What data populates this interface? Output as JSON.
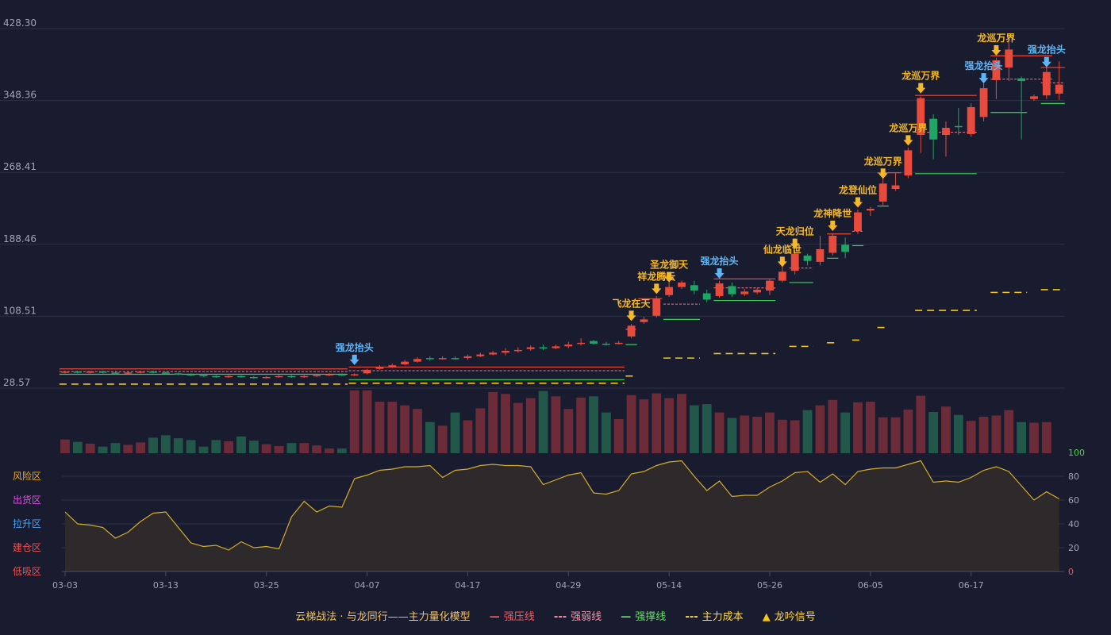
{
  "colors": {
    "background": "#191b2e",
    "grid": "#2e3146",
    "up": "#e84b3c",
    "down": "#1fa565",
    "up_dim": "#6b2b38",
    "down_dim": "#22584a",
    "resistance": "#e84b3c",
    "weak": "#f47c8f",
    "support": "#3ccf5a",
    "cost": "#f5c518",
    "signal_gold": "#f5b829",
    "signal_blue": "#5db5f5",
    "osc_line": "#d4ac2b",
    "osc_fill": "#2f2b2b",
    "axis_text": "#a4a4b4"
  },
  "chart_data": {
    "type": "candlestick",
    "price_axis": {
      "ticks": [
        "428.30",
        "348.36",
        "268.41",
        "188.46",
        "108.51",
        "28.57"
      ],
      "min": 28.57,
      "max": 428.3
    },
    "x_ticks": [
      {
        "label": "03-03",
        "index": 0
      },
      {
        "label": "03-13",
        "index": 8
      },
      {
        "label": "03-25",
        "index": 16
      },
      {
        "label": "04-07",
        "index": 24
      },
      {
        "label": "04-17",
        "index": 32
      },
      {
        "label": "04-29",
        "index": 40
      },
      {
        "label": "05-14",
        "index": 48
      },
      {
        "label": "05-26",
        "index": 56
      },
      {
        "label": "06-05",
        "index": 64
      },
      {
        "label": "06-17",
        "index": 72
      }
    ],
    "candles": [
      {
        "o": 46,
        "c": 47,
        "h": 48,
        "l": 45
      },
      {
        "o": 47,
        "c": 46,
        "h": 48,
        "l": 45
      },
      {
        "o": 46,
        "c": 47,
        "h": 48,
        "l": 45
      },
      {
        "o": 47,
        "c": 46,
        "h": 48,
        "l": 45
      },
      {
        "o": 46,
        "c": 45,
        "h": 47,
        "l": 44
      },
      {
        "o": 45,
        "c": 46,
        "h": 47,
        "l": 44
      },
      {
        "o": 46,
        "c": 47,
        "h": 48,
        "l": 45
      },
      {
        "o": 47,
        "c": 46,
        "h": 48,
        "l": 45
      },
      {
        "o": 46,
        "c": 45,
        "h": 47,
        "l": 44
      },
      {
        "o": 45,
        "c": 44,
        "h": 46,
        "l": 43
      },
      {
        "o": 44,
        "c": 43,
        "h": 45,
        "l": 42
      },
      {
        "o": 43,
        "c": 42,
        "h": 44,
        "l": 41
      },
      {
        "o": 42,
        "c": 41,
        "h": 43,
        "l": 40
      },
      {
        "o": 41,
        "c": 42,
        "h": 43,
        "l": 40
      },
      {
        "o": 42,
        "c": 41,
        "h": 43,
        "l": 40
      },
      {
        "o": 41,
        "c": 40,
        "h": 42,
        "l": 39
      },
      {
        "o": 40,
        "c": 41,
        "h": 42,
        "l": 39
      },
      {
        "o": 41,
        "c": 42,
        "h": 43,
        "l": 40
      },
      {
        "o": 42,
        "c": 41,
        "h": 43,
        "l": 40
      },
      {
        "o": 41,
        "c": 42,
        "h": 43,
        "l": 40
      },
      {
        "o": 42,
        "c": 43,
        "h": 44,
        "l": 41
      },
      {
        "o": 43,
        "c": 44,
        "h": 45,
        "l": 42
      },
      {
        "o": 44,
        "c": 43,
        "h": 45,
        "l": 42
      },
      {
        "o": 43,
        "c": 44,
        "h": 45,
        "l": 42
      },
      {
        "o": 45,
        "c": 49,
        "h": 50,
        "l": 44
      },
      {
        "o": 50,
        "c": 52,
        "h": 54,
        "l": 49
      },
      {
        "o": 52,
        "c": 54,
        "h": 56,
        "l": 51
      },
      {
        "o": 55,
        "c": 58,
        "h": 60,
        "l": 54
      },
      {
        "o": 58,
        "c": 61,
        "h": 63,
        "l": 57
      },
      {
        "o": 62,
        "c": 61,
        "h": 64,
        "l": 59
      },
      {
        "o": 61,
        "c": 62,
        "h": 64,
        "l": 60
      },
      {
        "o": 62,
        "c": 61,
        "h": 64,
        "l": 60
      },
      {
        "o": 62,
        "c": 64,
        "h": 66,
        "l": 60
      },
      {
        "o": 64,
        "c": 66,
        "h": 68,
        "l": 63
      },
      {
        "o": 66,
        "c": 68,
        "h": 70,
        "l": 65
      },
      {
        "o": 68,
        "c": 70,
        "h": 73,
        "l": 65
      },
      {
        "o": 70,
        "c": 71,
        "h": 74,
        "l": 68
      },
      {
        "o": 72,
        "c": 74,
        "h": 76,
        "l": 70
      },
      {
        "o": 74,
        "c": 73,
        "h": 77,
        "l": 71
      },
      {
        "o": 73,
        "c": 75,
        "h": 77,
        "l": 72
      },
      {
        "o": 75,
        "c": 77,
        "h": 80,
        "l": 73
      },
      {
        "o": 78,
        "c": 79,
        "h": 84,
        "l": 76
      },
      {
        "o": 81,
        "c": 78,
        "h": 82,
        "l": 77
      },
      {
        "o": 78,
        "c": 77,
        "h": 80,
        "l": 76
      },
      {
        "o": 78,
        "c": 79,
        "h": 81,
        "l": 77
      },
      {
        "o": 86,
        "c": 98,
        "h": 100,
        "l": 84
      },
      {
        "o": 102,
        "c": 105,
        "h": 108,
        "l": 100
      },
      {
        "o": 109,
        "c": 128,
        "h": 131,
        "l": 107
      },
      {
        "o": 132,
        "c": 141,
        "h": 151,
        "l": 130
      },
      {
        "o": 141,
        "c": 146,
        "h": 148,
        "l": 139
      },
      {
        "o": 143,
        "c": 137,
        "h": 148,
        "l": 133
      },
      {
        "o": 134,
        "c": 127,
        "h": 138,
        "l": 124
      },
      {
        "o": 131,
        "c": 145,
        "h": 148,
        "l": 129
      },
      {
        "o": 142,
        "c": 133,
        "h": 146,
        "l": 130
      },
      {
        "o": 133,
        "c": 136,
        "h": 139,
        "l": 131
      },
      {
        "o": 135,
        "c": 138,
        "h": 140,
        "l": 133
      },
      {
        "o": 137,
        "c": 148,
        "h": 150,
        "l": 132
      },
      {
        "o": 148,
        "c": 158,
        "h": 166,
        "l": 146
      },
      {
        "o": 159,
        "c": 178,
        "h": 182,
        "l": 155
      },
      {
        "o": 176,
        "c": 170,
        "h": 178,
        "l": 165
      },
      {
        "o": 169,
        "c": 183,
        "h": 198,
        "l": 165
      },
      {
        "o": 179,
        "c": 198,
        "h": 200,
        "l": 176
      },
      {
        "o": 188,
        "c": 180,
        "h": 196,
        "l": 173
      },
      {
        "o": 203,
        "c": 224,
        "h": 227,
        "l": 200
      },
      {
        "o": 226,
        "c": 228,
        "h": 230,
        "l": 220
      },
      {
        "o": 236,
        "c": 256,
        "h": 262,
        "l": 232
      },
      {
        "o": 250,
        "c": 254,
        "h": 268,
        "l": 248
      },
      {
        "o": 265,
        "c": 293,
        "h": 296,
        "l": 262
      },
      {
        "o": 310,
        "c": 351,
        "h": 353,
        "l": 290
      },
      {
        "o": 328,
        "c": 305,
        "h": 333,
        "l": 283
      },
      {
        "o": 310,
        "c": 318,
        "h": 325,
        "l": 286
      },
      {
        "o": 320,
        "c": 319,
        "h": 340,
        "l": 310
      },
      {
        "o": 311,
        "c": 341,
        "h": 345,
        "l": 308
      },
      {
        "o": 330,
        "c": 362,
        "h": 369,
        "l": 325
      },
      {
        "o": 371,
        "c": 393,
        "h": 396,
        "l": 350
      },
      {
        "o": 385,
        "c": 405,
        "h": 418,
        "l": 370
      },
      {
        "o": 373,
        "c": 370,
        "h": 375,
        "l": 305
      },
      {
        "o": 350,
        "c": 353,
        "h": 355,
        "l": 348
      },
      {
        "o": 354,
        "c": 380,
        "h": 388,
        "l": 350
      },
      {
        "o": 356,
        "c": 366,
        "h": 392,
        "l": 349
      }
    ],
    "volume": [
      23,
      19,
      16,
      11,
      17,
      14,
      18,
      26,
      30,
      25,
      22,
      11,
      22,
      20,
      28,
      21,
      15,
      12,
      17,
      17,
      13,
      8,
      8,
      105,
      105,
      86,
      86,
      80,
      74,
      52,
      46,
      68,
      55,
      75,
      102,
      99,
      84,
      92,
      104,
      95,
      74,
      93,
      95,
      68,
      57,
      97,
      90,
      100,
      92,
      99,
      80,
      82,
      68,
      59,
      63,
      61,
      68,
      56,
      55,
      72,
      80,
      89,
      68,
      85,
      86,
      60,
      60,
      73,
      96,
      69,
      78,
      64,
      54,
      61,
      63,
      72,
      52,
      51,
      52
    ],
    "volume_panel_max": 110,
    "oscillator": {
      "min": 0,
      "max": 100,
      "ticks": [
        "100",
        "80",
        "60",
        "40",
        "20",
        "0"
      ],
      "values": [
        50,
        40,
        39,
        37,
        28,
        33,
        42,
        49,
        50,
        37,
        24,
        21,
        22,
        18,
        25,
        20,
        21,
        19,
        46,
        59,
        50,
        55,
        54,
        78,
        81,
        85,
        86,
        88,
        88,
        89,
        79,
        85,
        86,
        89,
        90,
        89,
        89,
        88,
        73,
        77,
        81,
        83,
        66,
        65,
        68,
        82,
        84,
        89,
        92,
        93,
        80,
        68,
        76,
        63,
        64,
        64,
        71,
        76,
        83,
        84,
        75,
        82,
        73,
        84,
        86,
        87,
        87,
        90,
        93,
        75,
        76,
        75,
        79,
        85,
        88,
        84,
        72,
        60,
        67,
        61
      ],
      "zone_labels": [
        {
          "text": "风险区",
          "color": "#f5a623"
        },
        {
          "text": "出货区",
          "color": "#e94ae9"
        },
        {
          "text": "拉升区",
          "color": "#4aa3f5"
        },
        {
          "text": "建仓区",
          "color": "#f05151"
        },
        {
          "text": "低吸区",
          "color": "#f05151"
        }
      ]
    },
    "signals": [
      {
        "index": 23,
        "text": "强龙抬头",
        "type": "blue",
        "value": 49
      },
      {
        "index": 45,
        "text": "飞龙在天",
        "type": "gold",
        "value": 98
      },
      {
        "index": 47,
        "text": "祥龙腾云",
        "type": "gold",
        "value": 128
      },
      {
        "index": 48,
        "text": "圣龙御天",
        "type": "gold",
        "value": 141
      },
      {
        "index": 52,
        "text": "强龙抬头",
        "type": "blue",
        "value": 145
      },
      {
        "index": 57,
        "text": "仙龙临世",
        "type": "gold",
        "value": 158
      },
      {
        "index": 58,
        "text": "天龙归位",
        "type": "gold",
        "value": 178
      },
      {
        "index": 61,
        "text": "龙神降世",
        "type": "gold",
        "value": 198
      },
      {
        "index": 63,
        "text": "龙登仙位",
        "type": "gold",
        "value": 224
      },
      {
        "index": 65,
        "text": "龙巡万界",
        "type": "gold",
        "value": 256
      },
      {
        "index": 67,
        "text": "龙巡万界",
        "type": "gold",
        "value": 293
      },
      {
        "index": 68,
        "text": "龙巡万界",
        "type": "gold",
        "value": 351
      },
      {
        "index": 73,
        "text": "强龙抬头",
        "type": "blue",
        "value": 362
      },
      {
        "index": 74,
        "text": "龙巡万界",
        "type": "gold",
        "value": 393
      },
      {
        "index": 78,
        "text": "强龙抬头",
        "type": "blue",
        "value": 380
      }
    ],
    "levels": [
      {
        "type": "resistance",
        "start": 0,
        "end": 22,
        "value": 50
      },
      {
        "type": "weak",
        "start": 0,
        "end": 22,
        "value": 47
      },
      {
        "type": "support",
        "start": 0,
        "end": 22,
        "value": 44
      },
      {
        "type": "cost",
        "start": 0,
        "end": 22,
        "value": 33
      },
      {
        "type": "resistance",
        "start": 23,
        "end": 44,
        "value": 52
      },
      {
        "type": "weak",
        "start": 23,
        "end": 44,
        "value": 48
      },
      {
        "type": "support",
        "start": 23,
        "end": 44,
        "value": 38
      },
      {
        "type": "cost",
        "start": 23,
        "end": 44,
        "value": 34
      },
      {
        "type": "cost",
        "start": 45,
        "end": 45,
        "value": 42
      },
      {
        "type": "support",
        "start": 45,
        "end": 45,
        "value": 77
      },
      {
        "type": "weak",
        "start": 45,
        "end": 45,
        "value": 94
      },
      {
        "type": "resistance",
        "start": 46,
        "end": 47,
        "value": 128
      },
      {
        "type": "weak",
        "start": 48,
        "end": 50,
        "value": 122
      },
      {
        "type": "support",
        "start": 48,
        "end": 50,
        "value": 105
      },
      {
        "type": "cost",
        "start": 48,
        "end": 50,
        "value": 62
      },
      {
        "type": "resistance",
        "start": 52,
        "end": 56,
        "value": 150
      },
      {
        "type": "weak",
        "start": 52,
        "end": 56,
        "value": 140
      },
      {
        "type": "support",
        "start": 52,
        "end": 56,
        "value": 126
      },
      {
        "type": "cost",
        "start": 52,
        "end": 56,
        "value": 67
      },
      {
        "type": "cost",
        "start": 58,
        "end": 59,
        "value": 75
      },
      {
        "type": "weak",
        "start": 58,
        "end": 59,
        "value": 162
      },
      {
        "type": "support",
        "start": 58,
        "end": 59,
        "value": 146
      },
      {
        "type": "cost",
        "start": 61,
        "end": 61,
        "value": 79
      },
      {
        "type": "support",
        "start": 61,
        "end": 61,
        "value": 173
      },
      {
        "type": "resistance",
        "start": 61,
        "end": 62,
        "value": 200
      },
      {
        "type": "cost",
        "start": 63,
        "end": 63,
        "value": 82
      },
      {
        "type": "support",
        "start": 63,
        "end": 63,
        "value": 187
      },
      {
        "type": "weak",
        "start": 63,
        "end": 63,
        "value": 203
      },
      {
        "type": "cost",
        "start": 65,
        "end": 65,
        "value": 96
      },
      {
        "type": "support",
        "start": 65,
        "end": 65,
        "value": 231
      },
      {
        "type": "resistance",
        "start": 65,
        "end": 66,
        "value": 268
      },
      {
        "type": "resistance",
        "start": 68,
        "end": 72,
        "value": 354
      },
      {
        "type": "weak",
        "start": 68,
        "end": 72,
        "value": 313
      },
      {
        "type": "support",
        "start": 68,
        "end": 72,
        "value": 267
      },
      {
        "type": "cost",
        "start": 68,
        "end": 72,
        "value": 115
      },
      {
        "type": "resistance",
        "start": 74,
        "end": 78,
        "value": 398
      },
      {
        "type": "weak",
        "start": 74,
        "end": 78,
        "value": 372
      },
      {
        "type": "support",
        "start": 74,
        "end": 76,
        "value": 335
      },
      {
        "type": "cost",
        "start": 74,
        "end": 76,
        "value": 135
      },
      {
        "type": "resistance",
        "start": 78,
        "end": 79,
        "value": 385
      },
      {
        "type": "weak",
        "start": 78,
        "end": 79,
        "value": 368
      },
      {
        "type": "support",
        "start": 78,
        "end": 79,
        "value": 345
      },
      {
        "type": "cost",
        "start": 78,
        "end": 79,
        "value": 138
      }
    ]
  },
  "legend": {
    "title": "云梯战法 · 与龙同行——主力量化模型",
    "items": [
      {
        "marker": "—",
        "label": "强压线",
        "color": "#ff5a5a"
      },
      {
        "marker": "---",
        "label": "强弱线",
        "color": "#ff8fa3"
      },
      {
        "marker": "—",
        "label": "强撑线",
        "color": "#5fe35f"
      },
      {
        "marker": "---",
        "label": "主力成本",
        "color": "#ffd84a"
      },
      {
        "marker": "▲",
        "label": "龙吟信号",
        "color": "#f5c518"
      }
    ]
  }
}
